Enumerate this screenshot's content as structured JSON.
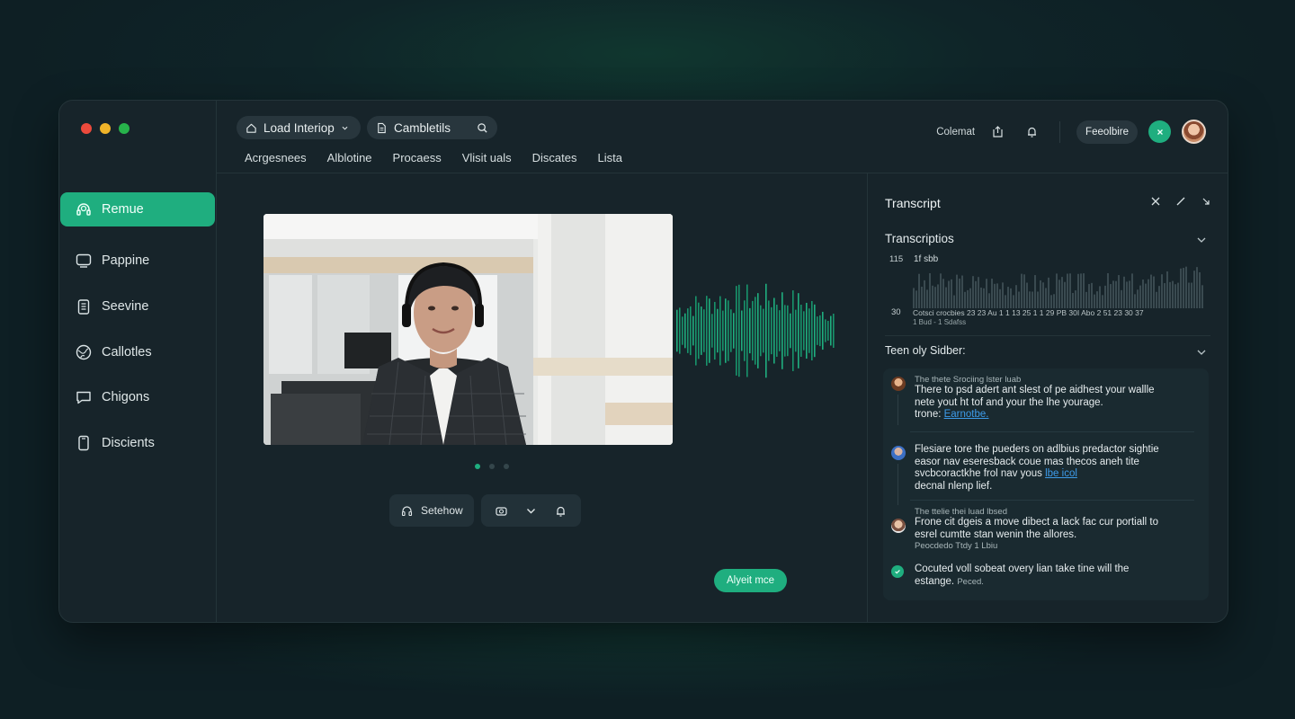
{
  "window": {
    "traffic_lights": [
      "#ec4a3c",
      "#f0b429",
      "#27b34b"
    ]
  },
  "sidebar": {
    "items": [
      {
        "label": "Remue",
        "icon": "headset-icon",
        "active": true
      },
      {
        "label": "Pappine",
        "icon": "monitor-icon",
        "active": false
      },
      {
        "label": "Seevine",
        "icon": "clipboard-icon",
        "active": false
      },
      {
        "label": "Callotles",
        "icon": "globe-icon",
        "active": false
      },
      {
        "label": "Chigons",
        "icon": "chat-icon",
        "active": false
      },
      {
        "label": "Discients",
        "icon": "phone-icon",
        "active": false
      }
    ]
  },
  "topbar": {
    "pill1": {
      "label": "Load Interiop",
      "icon": "home-icon"
    },
    "pill2": {
      "label": "Cambletils",
      "icon": "document-icon"
    },
    "menu": [
      "Acrgesnees",
      "Alblotine",
      "Procaess",
      "Vlisit uals",
      "Discates",
      "Lista"
    ],
    "right_label": "Colemat",
    "right_button": "Feeolbire"
  },
  "main": {
    "carousel_count": 3,
    "carousel_active": 0,
    "share_label": "Setehow",
    "apply_label": "Alyeit mce"
  },
  "panel": {
    "title": "Transcript",
    "section1": "Transcriptios",
    "chart_max_label": "115",
    "chart_min_label": "30",
    "chart_title": "1f sbb",
    "chart_caption1": "Cotsci crocbies 23 23 Au 1 1 13 25 1 1 29 PB 30I Abo 2 51 23 30 37",
    "chart_caption2": "1 Bud - 1 Sdafss",
    "section2": "Teen oly Sidber:",
    "messages": [
      {
        "meta": "The thete Srociing lster luab",
        "lines": [
          "There to psd adert ant slest of pe aidhest your wallle",
          "nete yout ht tof and your the lhe yourage."
        ],
        "tail_text": "trone: ",
        "link": "Earnotbe."
      },
      {
        "meta": "",
        "lines": [
          "Flesiare tore the pueders on adlbius predactor sightie",
          "easor nav eseresback coue mas thecos aneh tite",
          "svcbcoractkhe frol nav yous "
        ],
        "link": "lbe icol",
        "tail_text": "decnal nlenp lief."
      },
      {
        "meta": "The ttelie thei luad lbsed",
        "lines": [
          "Frone cit dgeis a move dibect a lack fac cur portiall to",
          "esrel cumtte stan wenin the allores."
        ],
        "tail_text": "Peocdedo Ttdy 1 Lbiu",
        "link": ""
      },
      {
        "meta": "",
        "lines": [
          "Cocuted voll sobeat overy lian take tine will the",
          "estange. "
        ],
        "tail_text": "Peced.",
        "link": ""
      }
    ]
  },
  "colors": {
    "accent": "#1fae7f",
    "background": "#0f2226",
    "window": "#17242a",
    "link": "#3d9be9"
  }
}
